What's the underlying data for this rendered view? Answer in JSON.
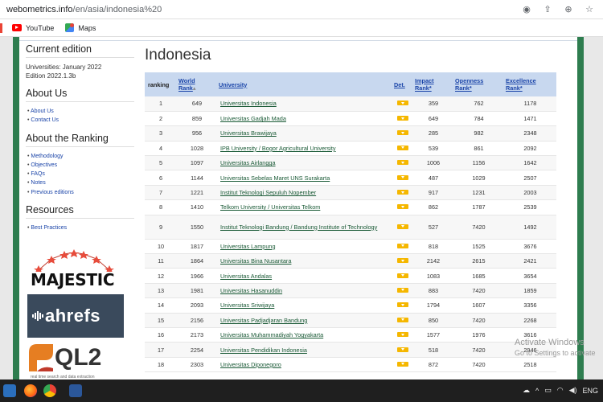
{
  "browser": {
    "url_host": "webometrics.info",
    "url_path": "/en/asia/indonesia%20",
    "bookmarks": [
      "YouTube",
      "Maps"
    ]
  },
  "sidebar": {
    "current_edition_heading": "Current edition",
    "edition_text_1": "Universities: January 2022",
    "edition_text_2": "Edition 2022.1.3b",
    "about_us_heading": "About Us",
    "about_us_links": [
      "About Us",
      "Contact Us"
    ],
    "about_ranking_heading": "About the Ranking",
    "about_ranking_links": [
      "Methodology",
      "Objectives",
      "FAQs",
      "Notes",
      "Previous editions"
    ],
    "resources_heading": "Resources",
    "resources_links": [
      "Best Practices"
    ],
    "logos": {
      "majestic": "MAJESTIC",
      "ahrefs": "ahrefs",
      "ql2": "QL2",
      "ql2_tagline": "real time search and data extraction"
    }
  },
  "main": {
    "title": "Indonesia",
    "columns": {
      "ranking": "ranking",
      "world_rank_1": "World",
      "world_rank_2": "Rank",
      "university": "University",
      "det": "Det.",
      "impact_1": "Impact",
      "impact_2": "Rank*",
      "openness_1": "Openness",
      "openness_2": "Rank*",
      "excellence_1": "Excellence",
      "excellence_2": "Rank*"
    },
    "rows": [
      {
        "rank": "1",
        "world": "649",
        "name": "Universitas Indonesia",
        "impact": "359",
        "openness": "762",
        "excellence": "1178"
      },
      {
        "rank": "2",
        "world": "859",
        "name": "Universitas Gadjah Mada",
        "impact": "649",
        "openness": "784",
        "excellence": "1471"
      },
      {
        "rank": "3",
        "world": "956",
        "name": "Universitas Brawijaya",
        "impact": "285",
        "openness": "982",
        "excellence": "2348"
      },
      {
        "rank": "4",
        "world": "1028",
        "name": "IPB University / Bogor Agricultural University",
        "impact": "539",
        "openness": "861",
        "excellence": "2092"
      },
      {
        "rank": "5",
        "world": "1097",
        "name": "Universitas Airlangga",
        "impact": "1006",
        "openness": "1156",
        "excellence": "1642"
      },
      {
        "rank": "6",
        "world": "1144",
        "name": "Universitas Sebelas Maret UNS Surakarta",
        "impact": "487",
        "openness": "1029",
        "excellence": "2507"
      },
      {
        "rank": "7",
        "world": "1221",
        "name": "Institut Teknologi Sepuluh Nopember",
        "impact": "917",
        "openness": "1231",
        "excellence": "2003"
      },
      {
        "rank": "8",
        "world": "1410",
        "name": "Telkom University / Universitas Telkom",
        "impact": "862",
        "openness": "1787",
        "excellence": "2539"
      },
      {
        "rank": "9",
        "world": "1550",
        "name": "Institut Teknologi Bandung / Bandung Institute of Technology",
        "impact": "527",
        "openness": "7420",
        "excellence": "1492"
      },
      {
        "rank": "10",
        "world": "1817",
        "name": "Universitas Lampung",
        "impact": "818",
        "openness": "1525",
        "excellence": "3676"
      },
      {
        "rank": "11",
        "world": "1864",
        "name": "Universitas Bina Nusantara",
        "impact": "2142",
        "openness": "2615",
        "excellence": "2421"
      },
      {
        "rank": "12",
        "world": "1966",
        "name": "Universitas Andalas",
        "impact": "1083",
        "openness": "1685",
        "excellence": "3654"
      },
      {
        "rank": "13",
        "world": "1981",
        "name": "Universitas Hasanuddin",
        "impact": "883",
        "openness": "7420",
        "excellence": "1859"
      },
      {
        "rank": "14",
        "world": "2093",
        "name": "Universitas Sriwijaya",
        "impact": "1794",
        "openness": "1607",
        "excellence": "3356"
      },
      {
        "rank": "15",
        "world": "2156",
        "name": "Universitas Padjadjaran Bandung",
        "impact": "850",
        "openness": "7420",
        "excellence": "2268"
      },
      {
        "rank": "16",
        "world": "2173",
        "name": "Universitas Muhammadiyah Yogyakarta",
        "impact": "1577",
        "openness": "1976",
        "excellence": "3616"
      },
      {
        "rank": "17",
        "world": "2254",
        "name": "Universitas Pendidikan Indonesia",
        "impact": "518",
        "openness": "7420",
        "excellence": "2946"
      },
      {
        "rank": "18",
        "world": "2303",
        "name": "Universitas Diponegoro",
        "impact": "872",
        "openness": "7420",
        "excellence": "2518"
      }
    ]
  },
  "watermark": {
    "line1": "Activate Windows",
    "line2": "Go to Settings to activate"
  },
  "taskbar": {
    "lang": "ENG"
  },
  "colors": {
    "page_frame": "#2e7d4f",
    "header_bg": "#c8d8ef",
    "link": "#1a44a8",
    "uni_link": "#1a5a36",
    "det_icon": "#f5b700"
  }
}
